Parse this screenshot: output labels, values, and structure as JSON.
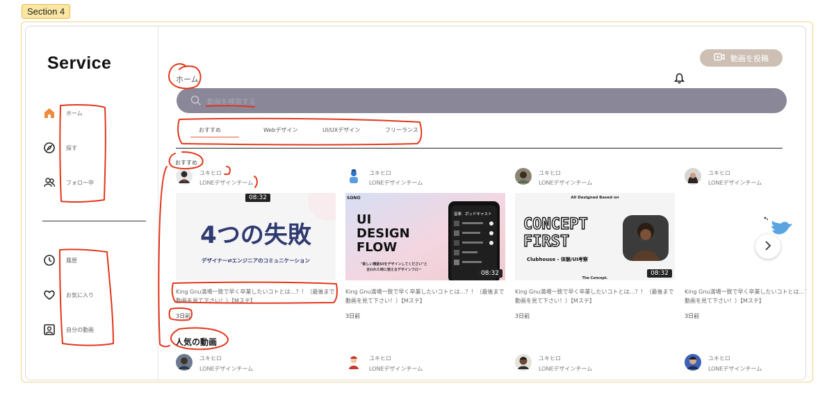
{
  "section_tag": "Section 4",
  "colors": {
    "accent": "#e35b3b",
    "search_bg": "#8a8799",
    "post_button": "#cdbfb4",
    "annotation_red": "#e2361b",
    "frame_gold": "#f0d489"
  },
  "sidebar": {
    "logo": "Service",
    "nav_top": [
      {
        "label": "ホーム",
        "icon": "home-icon",
        "active": true
      },
      {
        "label": "探す",
        "icon": "compass-icon"
      },
      {
        "label": "フォロー中",
        "icon": "people-icon"
      }
    ],
    "nav_bottom": [
      {
        "label": "履歴",
        "icon": "clock-icon"
      },
      {
        "label": "お気に入り",
        "icon": "heart-icon"
      },
      {
        "label": "自分の動画",
        "icon": "user-square-icon"
      }
    ]
  },
  "header": {
    "post_button": "動画を投稿",
    "page_title": "ホーム",
    "search_placeholder": "動画を検索する"
  },
  "tabs": [
    "おすすめ",
    "Webデザイン",
    "UI/UXデザイン",
    "フリーランス"
  ],
  "recommended": {
    "label": "おすすめ",
    "cards": [
      {
        "user": "ユキヒロ",
        "team": "LONEデザインチーム",
        "duration": "08:32",
        "title": "King Gnu満場一致で早く卒業したいコトとは…？！（最後まで動画を見て下さい！）【Mステ】",
        "time": "3日前",
        "thumb": {
          "line1": "4つの失敗",
          "line2": "デザイナー⇄エンジニアのコミュニケーション"
        }
      },
      {
        "user": "ユキヒロ",
        "team": "LONEデザインチーム",
        "duration": "08:32",
        "title": "King Gnu満場一致で早く卒業したいコトとは…？！（最後まで動画を見て下さい！）【Mステ】",
        "time": "3日前",
        "thumb": {
          "brand": "SONO",
          "line1": "UI",
          "line2": "DESIGN",
          "line3": "FLOW",
          "caption1": "\"新しい機能UIをデザインしてください\"と",
          "caption2": "言われた時に使えるデザインフロー",
          "phone_tab1": "音楽",
          "phone_tab2": "ポッドキャスト"
        }
      },
      {
        "user": "ユキヒロ",
        "team": "LONEデザインチーム",
        "duration": "08:32",
        "title": "King Gnu満場一致で早く卒業したいコトとは…？！（最後まで動画を見て下さい！）【Mステ】",
        "time": "3日前",
        "thumb": {
          "top": "All Designed Based on",
          "line1": "CONCEPT",
          "line2": "FIRST",
          "caption": "Clubhouse - 体験/UI考察",
          "bottom": "The Concept."
        }
      },
      {
        "user": "ユキヒロ",
        "team": "LONEデザインチーム",
        "title": "King Gnu満場一致で早く卒業したいコトとは…？！（最後まで動画を見て下さい！）【Mステ】",
        "time": "3日前"
      }
    ]
  },
  "popular": {
    "title": "人気の動画",
    "cards": [
      {
        "user": "ユキヒロ",
        "team": "LONEデザインチーム"
      },
      {
        "user": "ユキヒロ",
        "team": "LONEデザインチーム"
      },
      {
        "user": "ユキヒロ",
        "team": "LONEデザインチーム"
      },
      {
        "user": "ユキヒロ",
        "team": "LONEデザインチーム"
      }
    ]
  }
}
